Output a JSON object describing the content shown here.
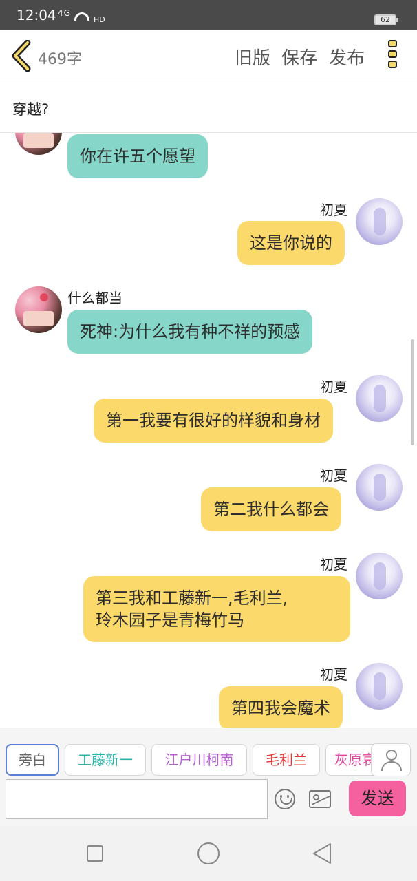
{
  "status": {
    "time": "12:04",
    "signal": "4G",
    "hd": "HD",
    "battery": "62"
  },
  "topbar": {
    "word_count": "469字",
    "old_version": "旧版",
    "save": "保存",
    "publish": "发布"
  },
  "story": {
    "title": "穿越?"
  },
  "messages": [
    {
      "side": "left",
      "text": "你在许五个愿望"
    },
    {
      "side": "right",
      "name": "初夏",
      "text": "这是你说的"
    },
    {
      "side": "left",
      "name": "什么都当",
      "text": "死神:为什么我有种不祥的预感"
    },
    {
      "side": "right",
      "name": "初夏",
      "text": "第一我要有很好的样貌和身材"
    },
    {
      "side": "right",
      "name": "初夏",
      "text": "第二我什么都会"
    },
    {
      "side": "right",
      "name": "初夏",
      "text": "第三我和工藤新一,毛利兰,",
      "text2": "玲木园子是青梅竹马"
    },
    {
      "side": "right",
      "name": "初夏",
      "text": "第四我会魔术"
    }
  ],
  "characters": [
    {
      "label": "旁白",
      "color": "#666666"
    },
    {
      "label": "工藤新一",
      "color": "#2ab3a6"
    },
    {
      "label": "江户川柯南",
      "color": "#b45fd0"
    },
    {
      "label": "毛利兰",
      "color": "#e23a3a"
    },
    {
      "label": "灰原哀",
      "color": "#e04aa0"
    }
  ],
  "composer": {
    "placeholder": "",
    "send_label": "发送"
  }
}
